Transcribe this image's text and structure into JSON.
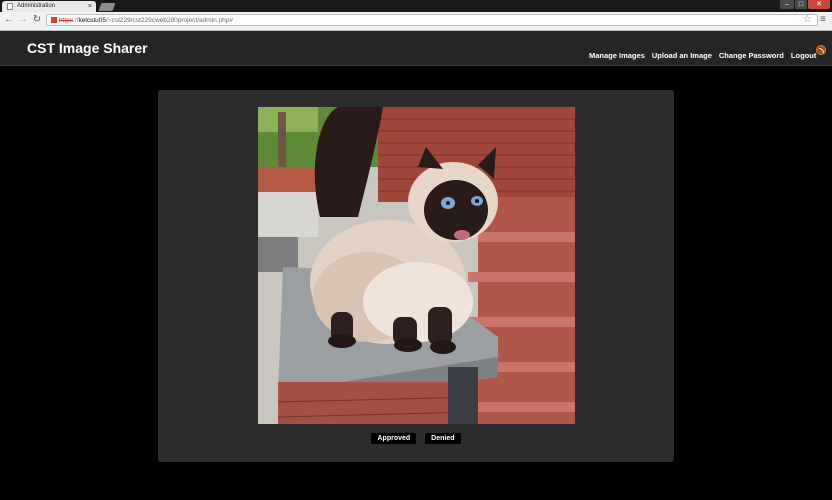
{
  "browser": {
    "tab_title": "Administration",
    "tab_close": "×",
    "url_scheme": "https",
    "url_sep": "://",
    "url_host": "kelcstu05",
    "url_path": "/~cst229/cst229cweb280project/admin.php#",
    "controls": {
      "minimize": "–",
      "maximize": "□",
      "close": "✕"
    },
    "nav": {
      "back": "←",
      "forward": "→",
      "reload": "↻"
    },
    "star": "☆",
    "menu": "≡"
  },
  "site": {
    "title": "CST Image Sharer",
    "nav": [
      "Manage Images",
      "Upload an Image",
      "Change Password",
      "Logout"
    ]
  },
  "review": {
    "approve_label": "Approved",
    "deny_label": "Denied"
  }
}
